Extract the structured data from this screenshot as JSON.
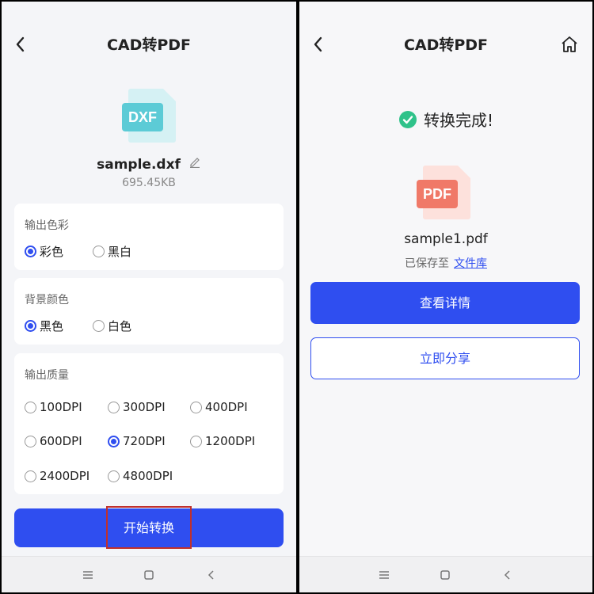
{
  "left": {
    "title": "CAD转PDF",
    "file": {
      "type_label": "DXF",
      "name": "sample.dxf",
      "size": "695.45KB",
      "icon": "dxf-file-icon"
    },
    "output_color": {
      "label": "输出色彩",
      "options": [
        "彩色",
        "黑白"
      ],
      "selected": "彩色"
    },
    "background_color": {
      "label": "背景颜色",
      "options": [
        "黑色",
        "白色"
      ],
      "selected": "黑色"
    },
    "quality": {
      "label": "输出质量",
      "options": [
        "100DPI",
        "300DPI",
        "400DPI",
        "600DPI",
        "720DPI",
        "1200DPI",
        "2400DPI",
        "4800DPI"
      ],
      "selected": "720DPI"
    },
    "start_button": "开始转换"
  },
  "right": {
    "title": "CAD转PDF",
    "status": "转换完成!",
    "file": {
      "type_label": "PDF",
      "name": "sample1.pdf",
      "icon": "pdf-file-icon"
    },
    "saved_prefix": "已保存至",
    "saved_link": "文件库",
    "view_button": "查看详情",
    "share_button": "立即分享"
  },
  "colors": {
    "accent": "#2f4ef0",
    "success": "#2fc28a",
    "dxf": "#5ccbd6",
    "pdf": "#f07968",
    "highlight": "#c0302c"
  }
}
